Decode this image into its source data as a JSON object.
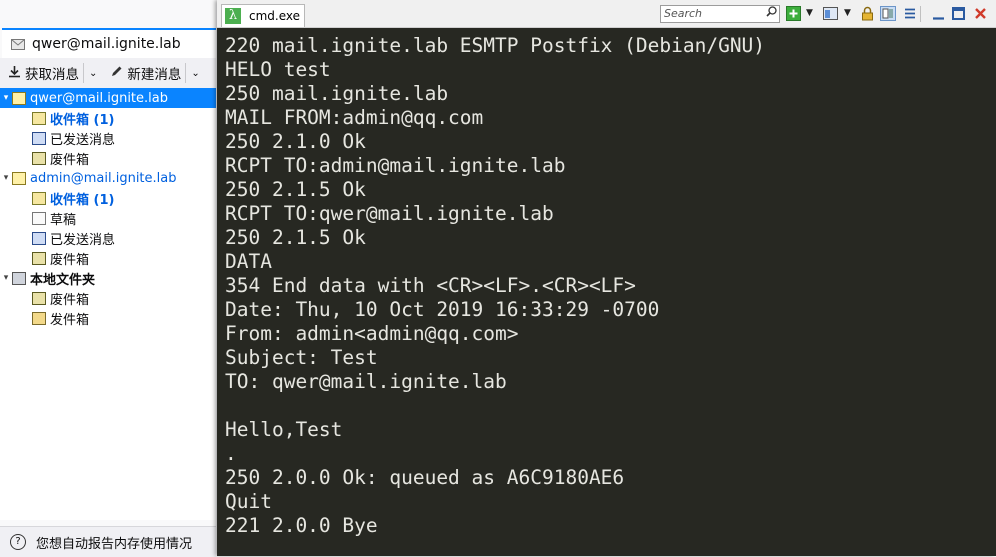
{
  "thunderbird": {
    "tab_title": "qwer@mail.ignite.lab",
    "toolbar": {
      "get_messages": "获取消息",
      "new_message": "新建消息"
    },
    "folders": [
      {
        "label": "qwer@mail.ignite.lab",
        "kind": "account",
        "selected": true
      },
      {
        "label": "收件箱 (1)",
        "kind": "inbox",
        "unread": true
      },
      {
        "label": "已发送消息",
        "kind": "sent"
      },
      {
        "label": "废件箱",
        "kind": "trash"
      },
      {
        "label": "admin@mail.ignite.lab",
        "kind": "account"
      },
      {
        "label": "收件箱 (1)",
        "kind": "inbox",
        "unread": true
      },
      {
        "label": "草稿",
        "kind": "drafts"
      },
      {
        "label": "已发送消息",
        "kind": "sent"
      },
      {
        "label": "废件箱",
        "kind": "trash"
      },
      {
        "label": "本地文件夹",
        "kind": "local"
      },
      {
        "label": "废件箱",
        "kind": "trash"
      },
      {
        "label": "发件箱",
        "kind": "outbox"
      }
    ],
    "status_text": "您想自动报告内存使用情况"
  },
  "console": {
    "tab_title": "cmd.exe",
    "search_placeholder": "Search",
    "lines": [
      "220 mail.ignite.lab ESMTP Postfix (Debian/GNU)",
      "HELO test",
      "250 mail.ignite.lab",
      "MAIL FROM:admin@qq.com",
      "250 2.1.0 Ok",
      "RCPT TO:admin@mail.ignite.lab",
      "250 2.1.5 Ok",
      "RCPT TO:qwer@mail.ignite.lab",
      "250 2.1.5 Ok",
      "DATA",
      "354 End data with <CR><LF>.<CR><LF>",
      "Date: Thu, 10 Oct 2019 16:33:29 -0700",
      "From: admin<admin@qq.com>",
      "Subject: Test",
      "TO: qwer@mail.ignite.lab",
      "",
      "Hello,Test",
      ".",
      "250 2.0.0 Ok: queued as A6C9180AE6",
      "Quit",
      "221 2.0.0 Bye"
    ]
  }
}
